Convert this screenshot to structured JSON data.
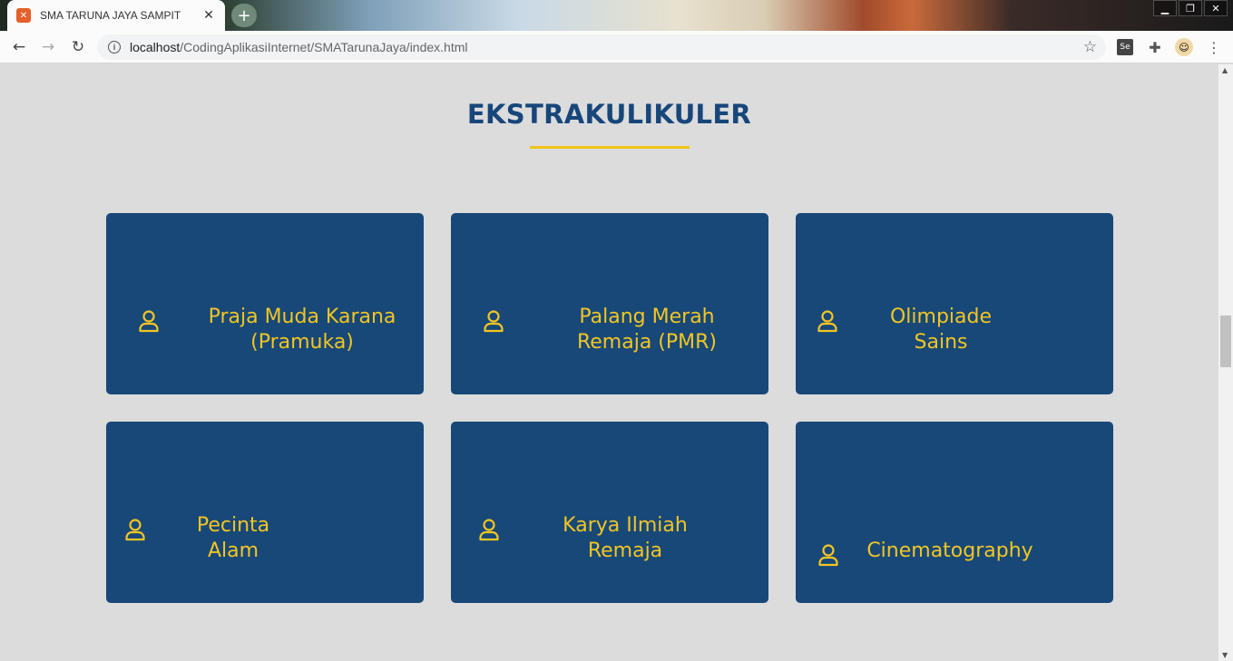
{
  "browser": {
    "tab_title": "SMA TARUNA JAYA SAMPIT",
    "tab_close": "✕",
    "new_tab": "+",
    "url_host": "localhost",
    "url_path": "/CodingAplikasiInternet/SMATarunaJaya/index.html",
    "window_controls": [
      "▁",
      "❐",
      "✕"
    ],
    "extension_se": "Se"
  },
  "section": {
    "title": "EKSTRAKULIKULER"
  },
  "cards": [
    {
      "line1": "Praja Muda Karana",
      "line2": "(Pramuka)",
      "icon": "user-icon"
    },
    {
      "line1": "Palang Merah",
      "line2": "Remaja (PMR)",
      "icon": "user-icon"
    },
    {
      "line1": "Olimpiade",
      "line2": "Sains",
      "icon": "user-icon"
    },
    {
      "line1": "Pecinta",
      "line2": "Alam",
      "icon": "user-icon"
    },
    {
      "line1": "Karya Ilmiah",
      "line2": "Remaja",
      "icon": "user-icon"
    },
    {
      "line1": "Cinematography",
      "line2": "",
      "icon": "user-icon"
    }
  ],
  "colors": {
    "card_bg": "#174878",
    "accent_yellow": "#f2c523",
    "title_blue": "#17467a",
    "page_bg": "#dcdcdc"
  }
}
